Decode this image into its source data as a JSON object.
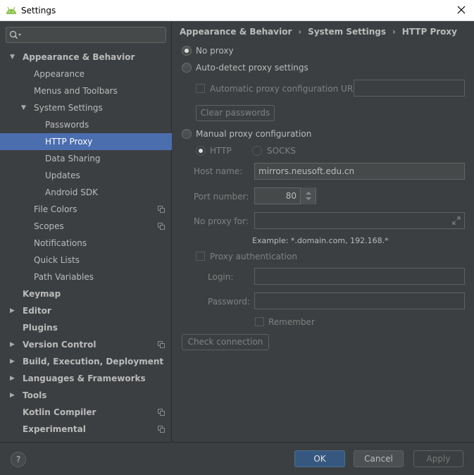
{
  "window": {
    "title": "Settings"
  },
  "sidebar": {
    "search_placeholder": "",
    "items": [
      {
        "label": "Appearance & Behavior",
        "level": 0,
        "arrow": "expanded",
        "bold": true
      },
      {
        "label": "Appearance",
        "level": 1
      },
      {
        "label": "Menus and Toolbars",
        "level": 1
      },
      {
        "label": "System Settings",
        "level": 1,
        "arrow": "expanded"
      },
      {
        "label": "Passwords",
        "level": 2
      },
      {
        "label": "HTTP Proxy",
        "level": 2,
        "selected": true
      },
      {
        "label": "Data Sharing",
        "level": 2
      },
      {
        "label": "Updates",
        "level": 2
      },
      {
        "label": "Android SDK",
        "level": 2
      },
      {
        "label": "File Colors",
        "level": 1,
        "copy_icon": true
      },
      {
        "label": "Scopes",
        "level": 1,
        "copy_icon": true
      },
      {
        "label": "Notifications",
        "level": 1
      },
      {
        "label": "Quick Lists",
        "level": 1
      },
      {
        "label": "Path Variables",
        "level": 1
      },
      {
        "label": "Keymap",
        "level": 0,
        "bold": true
      },
      {
        "label": "Editor",
        "level": 0,
        "arrow": "collapsed",
        "bold": true
      },
      {
        "label": "Plugins",
        "level": 0,
        "bold": true
      },
      {
        "label": "Version Control",
        "level": 0,
        "arrow": "collapsed",
        "bold": true,
        "copy_icon": true
      },
      {
        "label": "Build, Execution, Deployment",
        "level": 0,
        "arrow": "collapsed",
        "bold": true
      },
      {
        "label": "Languages & Frameworks",
        "level": 0,
        "arrow": "collapsed",
        "bold": true
      },
      {
        "label": "Tools",
        "level": 0,
        "arrow": "collapsed",
        "bold": true
      },
      {
        "label": "Kotlin Compiler",
        "level": 0,
        "bold": true,
        "copy_icon": true
      },
      {
        "label": "Experimental",
        "level": 0,
        "bold": true,
        "copy_icon": true
      }
    ]
  },
  "breadcrumb": {
    "parts": [
      "Appearance & Behavior",
      "System Settings",
      "HTTP Proxy"
    ],
    "separator": "›"
  },
  "proxy": {
    "no_proxy_label": "No proxy",
    "auto_detect_label": "Auto-detect proxy settings",
    "auto_config_url_label": "Automatic proxy configuration URL:",
    "auto_config_url_value": "",
    "clear_passwords_label": "Clear passwords",
    "manual_label": "Manual proxy configuration",
    "http_label": "HTTP",
    "socks_label": "SOCKS",
    "host_label": "Host name:",
    "host_value": "mirrors.neusoft.edu.cn",
    "port_label": "Port number:",
    "port_value": "80",
    "no_proxy_for_label": "No proxy for:",
    "no_proxy_for_value": "",
    "example_text": "Example: *.domain.com, 192.168.*",
    "auth_label": "Proxy authentication",
    "login_label": "Login:",
    "login_value": "",
    "password_label": "Password:",
    "password_value": "",
    "remember_label": "Remember",
    "check_connection_label": "Check connection",
    "selected_mode": "No proxy"
  },
  "footer": {
    "help_label": "?",
    "ok_label": "OK",
    "cancel_label": "Cancel",
    "apply_label": "Apply"
  },
  "colors": {
    "background": "#3c3f41",
    "selection": "#4b6eaf",
    "primary_button": "#365880",
    "text": "#bbbbbb",
    "disabled_text": "#808080"
  }
}
